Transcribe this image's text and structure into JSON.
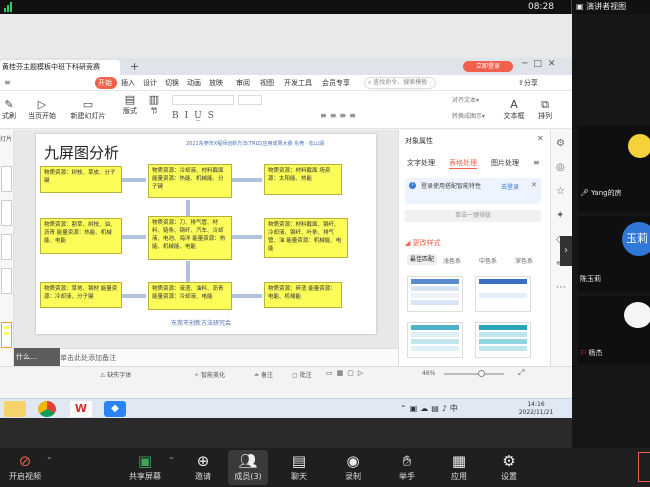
{
  "topbar": {
    "time": "08:28",
    "speaker_view": "演讲者视图"
  },
  "wps": {
    "doc_tab": "黄桂芬主题模板中班下科研竞赛",
    "login_button": "立即登录",
    "ribbon_tabs": [
      "开始",
      "插入",
      "设计",
      "切换",
      "动画",
      "放映",
      "审阅",
      "视图",
      "开发工具",
      "会员专享"
    ],
    "search": "查找命令、搜索模板",
    "share": "分享",
    "ribbon_buttons": [
      "式刷",
      "当页开始",
      "新建幻灯片",
      "版式",
      "节",
      "文本框",
      "排列"
    ],
    "ribbon_labels": [
      "文本框",
      "排列"
    ],
    "left_label": "灯片",
    "slide": {
      "title": "九屏图分析",
      "header_right": "2021东莞市X程师创新方法(TRIZ)应用成果大赛  东莞 · 松山湖",
      "footer": "东莞市创新方法研究会",
      "boxes": [
        "物质资源：树枝、草皮、分子键",
        "物质资源：冷却液、材料截面\n能量资源：热能、机械能、分子键",
        "物质资源：材料截面\n场资源：太阳能、热能",
        "物质资源：割草、树枝、油、沥青\n能量资源：热能、机械能、电能",
        "物质资源：刀、排气管、材料、链条、钢纤、汽车、冷却液、电池、海洋\n能量资源：热能、机械能、电能",
        "物质资源：材料截面、钢纤、冷却液、钢纤、叶条、排气管、油\n能量资源：机械能、电能",
        "物质资源：草地、钢材\n能量资源：冷却液、分子键",
        "物质资源：液渣、油料、沥青\n能量资源：冷却液、电能",
        "物质资源：碎渣\n能量资源：电能、机械能"
      ]
    },
    "notes_placeholder": "单击此处添加备注",
    "notes_hint": "什么…",
    "status": {
      "smart": "智能美化",
      "notes": "备注",
      "comments": "批注",
      "zoom": "46%",
      "font_missing": "缺失字体"
    },
    "panel": {
      "title": "对象属性",
      "tabs": [
        "文字处理",
        "表格处理",
        "图片处理"
      ],
      "login_tip": "登录使用搭配智能特性",
      "login_link": "去登录",
      "apply_button": "单击一键排版",
      "more_styles": "更改样式",
      "style_tabs": [
        "最佳匹配",
        "浅色系",
        "中色系",
        "深色系"
      ]
    }
  },
  "taskbar": {
    "clock_time": "14:16",
    "clock_date": "2022/11/21"
  },
  "gallery": {
    "participants": [
      {
        "name": "Yang的房",
        "avatar_text": ""
      },
      {
        "name": "陈玉莉",
        "avatar_text": "玉莉"
      },
      {
        "name": "杨杰",
        "avatar_text": ""
      }
    ]
  },
  "meeting": {
    "buttons": [
      "开启视频",
      "共享屏幕",
      "邀请",
      "成员(3)",
      "聊天",
      "录制",
      "举手",
      "应用",
      "设置"
    ]
  },
  "colors": {
    "accent": "#f0604b",
    "slide_box": "#fdfd5a",
    "toolbar": "#1f1f1f"
  }
}
